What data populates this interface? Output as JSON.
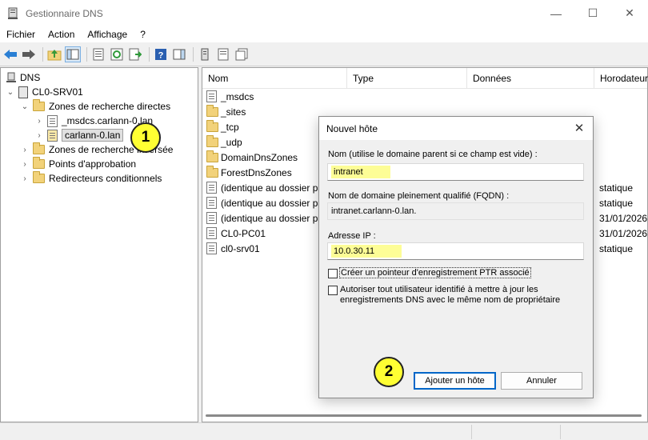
{
  "window": {
    "title": "Gestionnaire DNS",
    "minimize": "—",
    "maximize": "☐",
    "close": "✕"
  },
  "menu": [
    "Fichier",
    "Action",
    "Affichage",
    "?"
  ],
  "tree": {
    "root": "DNS",
    "server": "CL0-SRV01",
    "forward_zones": "Zones de recherche directes",
    "msdcs_zone": "_msdcs.carlann-0.lan",
    "selected_zone": "carlann-0.lan",
    "reverse_zones": "Zones de recherche inversée",
    "trust_points": "Points d'approbation",
    "conditional_forwarders": "Redirecteurs conditionnels"
  },
  "list": {
    "columns": [
      "Nom",
      "Type",
      "Données",
      "Horodateur"
    ],
    "rows": [
      {
        "name": "_msdcs",
        "timestamp": ""
      },
      {
        "name": "_sites",
        "timestamp": ""
      },
      {
        "name": "_tcp",
        "timestamp": ""
      },
      {
        "name": "_udp",
        "timestamp": ""
      },
      {
        "name": "DomainDnsZones",
        "timestamp": ""
      },
      {
        "name": "ForestDnsZones",
        "timestamp": ""
      },
      {
        "name": "(identique au dossier pa",
        "timestamp": "statique"
      },
      {
        "name": "(identique au dossier pa",
        "timestamp": "statique"
      },
      {
        "name": "(identique au dossier pa",
        "timestamp": "31/01/2026"
      },
      {
        "name": "CL0-PC01",
        "timestamp": "31/01/2026"
      },
      {
        "name": "cl0-srv01",
        "timestamp": "statique"
      }
    ]
  },
  "dialog": {
    "title": "Nouvel hôte",
    "close": "✕",
    "name_label": "Nom (utilise le domaine parent si ce champ est vide) :",
    "name_value": "intranet",
    "fqdn_label": "Nom de domaine pleinement qualifié (FQDN) :",
    "fqdn_value": "intranet.carlann-0.lan.",
    "ip_label": "Adresse IP :",
    "ip_value": "10.0.30.11",
    "ptr_checkbox": "Créer un pointeur d'enregistrement PTR associé",
    "update_checkbox_line1": "Autoriser tout utilisateur identifié à mettre à jour les",
    "update_checkbox_line2": "enregistrements DNS avec le même nom de propriétaire",
    "add_button": "Ajouter un hôte",
    "cancel_button": "Annuler"
  },
  "annotations": {
    "step1": "1",
    "step2": "2"
  }
}
